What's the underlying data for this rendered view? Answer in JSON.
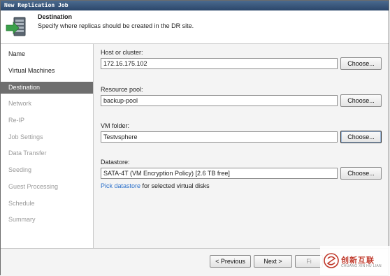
{
  "window": {
    "title": "New Replication Job"
  },
  "header": {
    "title": "Destination",
    "subtitle": "Specify where replicas should be created in the DR site."
  },
  "sidebar": {
    "items": [
      {
        "label": "Name",
        "state": "done"
      },
      {
        "label": "Virtual Machines",
        "state": "done"
      },
      {
        "label": "Destination",
        "state": "active"
      },
      {
        "label": "Network",
        "state": "pending"
      },
      {
        "label": "Re-IP",
        "state": "pending"
      },
      {
        "label": "Job Settings",
        "state": "pending"
      },
      {
        "label": "Data Transfer",
        "state": "pending"
      },
      {
        "label": "Seeding",
        "state": "pending"
      },
      {
        "label": "Guest Processing",
        "state": "pending"
      },
      {
        "label": "Schedule",
        "state": "pending"
      },
      {
        "label": "Summary",
        "state": "pending"
      }
    ]
  },
  "form": {
    "host": {
      "label": "Host or cluster:",
      "value": "172.16.175.102",
      "button": "Choose..."
    },
    "pool": {
      "label": "Resource pool:",
      "value": "backup-pool",
      "button": "Choose..."
    },
    "folder": {
      "label": "VM folder:",
      "value": "Testvsphere",
      "button": "Choose..."
    },
    "datastore": {
      "label": "Datastore:",
      "value": "SATA-4T (VM Encryption Policy) [2.6 TB free]",
      "button": "Choose..."
    },
    "pick_link": "Pick datastore",
    "pick_suffix": "for selected virtual disks"
  },
  "footer": {
    "previous": "< Previous",
    "next": "Next >",
    "finish": "Fi"
  },
  "watermark": {
    "text": "创新互联",
    "sub": "CHUANG XIN HU LIAN"
  },
  "colors": {
    "accent_green": "#3aa04a",
    "link": "#2a6fc9",
    "active_nav": "#6e6e6e",
    "watermark_red": "#c0392b"
  }
}
